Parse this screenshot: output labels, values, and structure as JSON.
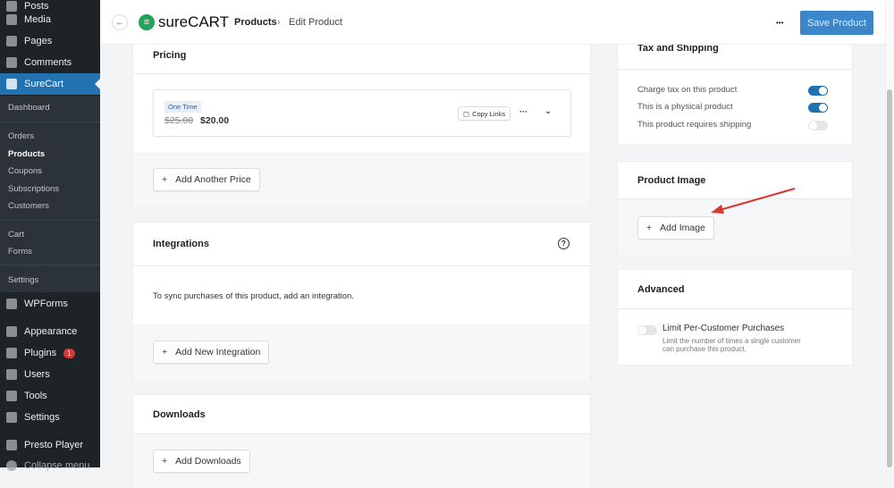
{
  "sidebar": {
    "top": [
      {
        "label": "Posts",
        "icon": "pin-icon"
      },
      {
        "label": "Media",
        "icon": "media-icon"
      },
      {
        "label": "Pages",
        "icon": "pages-icon"
      },
      {
        "label": "Comments",
        "icon": "comment-icon"
      }
    ],
    "active": {
      "label": "SureCart",
      "icon": "surecart-icon"
    },
    "submenu": [
      "Dashboard",
      "Orders",
      "Products",
      "Coupons",
      "Subscriptions",
      "Customers",
      "Cart",
      "Forms",
      "Settings"
    ],
    "bottom": [
      {
        "label": "WPForms",
        "icon": "wpforms-icon"
      },
      {
        "label": "Appearance",
        "icon": "brush-icon"
      },
      {
        "label": "Plugins",
        "icon": "plugin-icon",
        "badge": "1"
      },
      {
        "label": "Users",
        "icon": "user-icon"
      },
      {
        "label": "Tools",
        "icon": "wrench-icon"
      },
      {
        "label": "Settings",
        "icon": "settings-icon"
      },
      {
        "label": "Presto Player",
        "icon": "play-icon"
      },
      {
        "label": "Collapse menu",
        "icon": "collapse-icon"
      }
    ]
  },
  "header": {
    "logo": "sureCART",
    "crumbs": [
      "Products",
      "Edit Product"
    ],
    "more": "•••",
    "save": "Save Product",
    "accent": "#3c87c9"
  },
  "pricing": {
    "title": "Pricing",
    "badge": "One Time",
    "old_price": "$25.00",
    "price": "$20.00",
    "copy": "Copy Links",
    "add": "Add Another Price"
  },
  "integrations": {
    "title": "Integrations",
    "text": "To sync purchases of this product, add an integration.",
    "add": "Add New Integration"
  },
  "downloads": {
    "title": "Downloads",
    "add": "Add Downloads"
  },
  "tax": {
    "title": "Tax and Shipping",
    "options": [
      {
        "label": "Charge tax on this product",
        "on": true
      },
      {
        "label": "This is a physical product",
        "on": true
      },
      {
        "label": "This product requires shipping",
        "on": false
      }
    ]
  },
  "image": {
    "title": "Product Image",
    "add": "Add Image"
  },
  "advanced": {
    "title": "Advanced",
    "label": "Limit Per-Customer Purchases",
    "on": false,
    "desc1": "Limit the number of times a single customer",
    "desc2": "can purchase this product."
  }
}
